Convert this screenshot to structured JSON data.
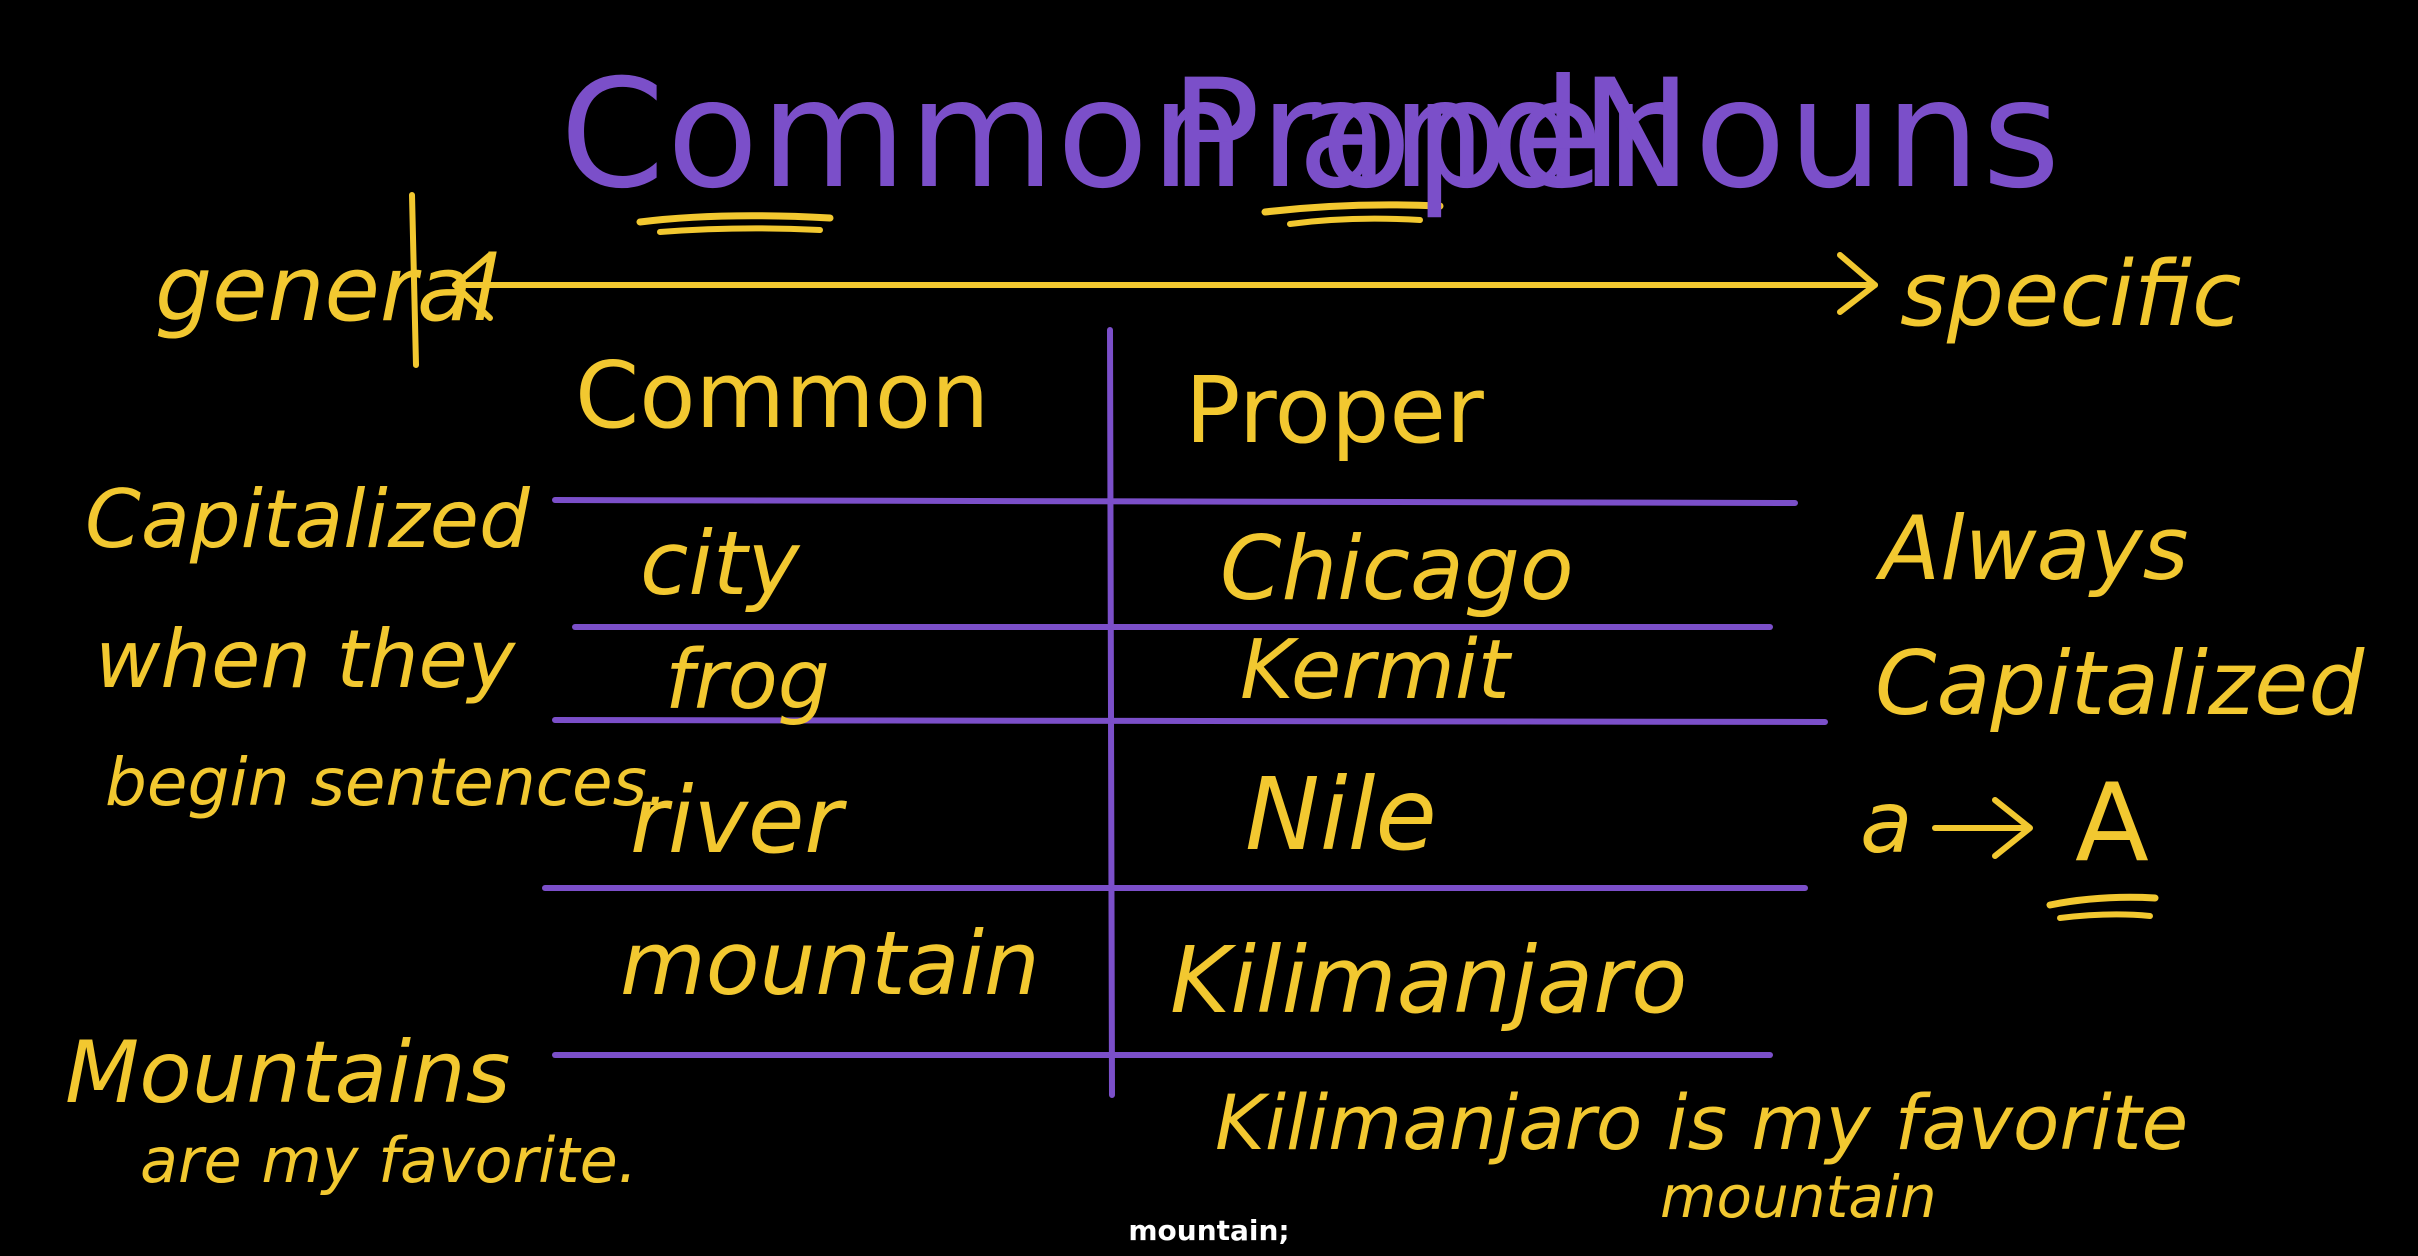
{
  "title": {
    "part1": "Common and",
    "part2": "Proper",
    "part3": "Nouns"
  },
  "spectrum": {
    "left": "general",
    "right": "specific"
  },
  "table": {
    "headers": {
      "common": "Common",
      "proper": "Proper"
    },
    "rows": [
      {
        "common": "city",
        "proper": "Chicago"
      },
      {
        "common": "frog",
        "proper": "Kermit"
      },
      {
        "common": "river",
        "proper": "Nile"
      },
      {
        "common": "mountain",
        "proper": "Kilimanjaro"
      }
    ]
  },
  "left_notes": {
    "capitalized": [
      "Capitalized",
      "when they",
      "begin sentences."
    ],
    "example": [
      "Mountains",
      "are my favorite."
    ]
  },
  "right_notes": {
    "always": [
      "Always",
      "Capitalized"
    ],
    "arrow_example": {
      "from": "a",
      "to": "A"
    },
    "example": [
      "Kilimanjaro is my favorite",
      "mountain"
    ]
  },
  "caption": "mountain;",
  "colors": {
    "background": "#000000",
    "purple": "#7B4FC9",
    "yellow": "#F2C830",
    "caption": "#FFFFFF"
  }
}
